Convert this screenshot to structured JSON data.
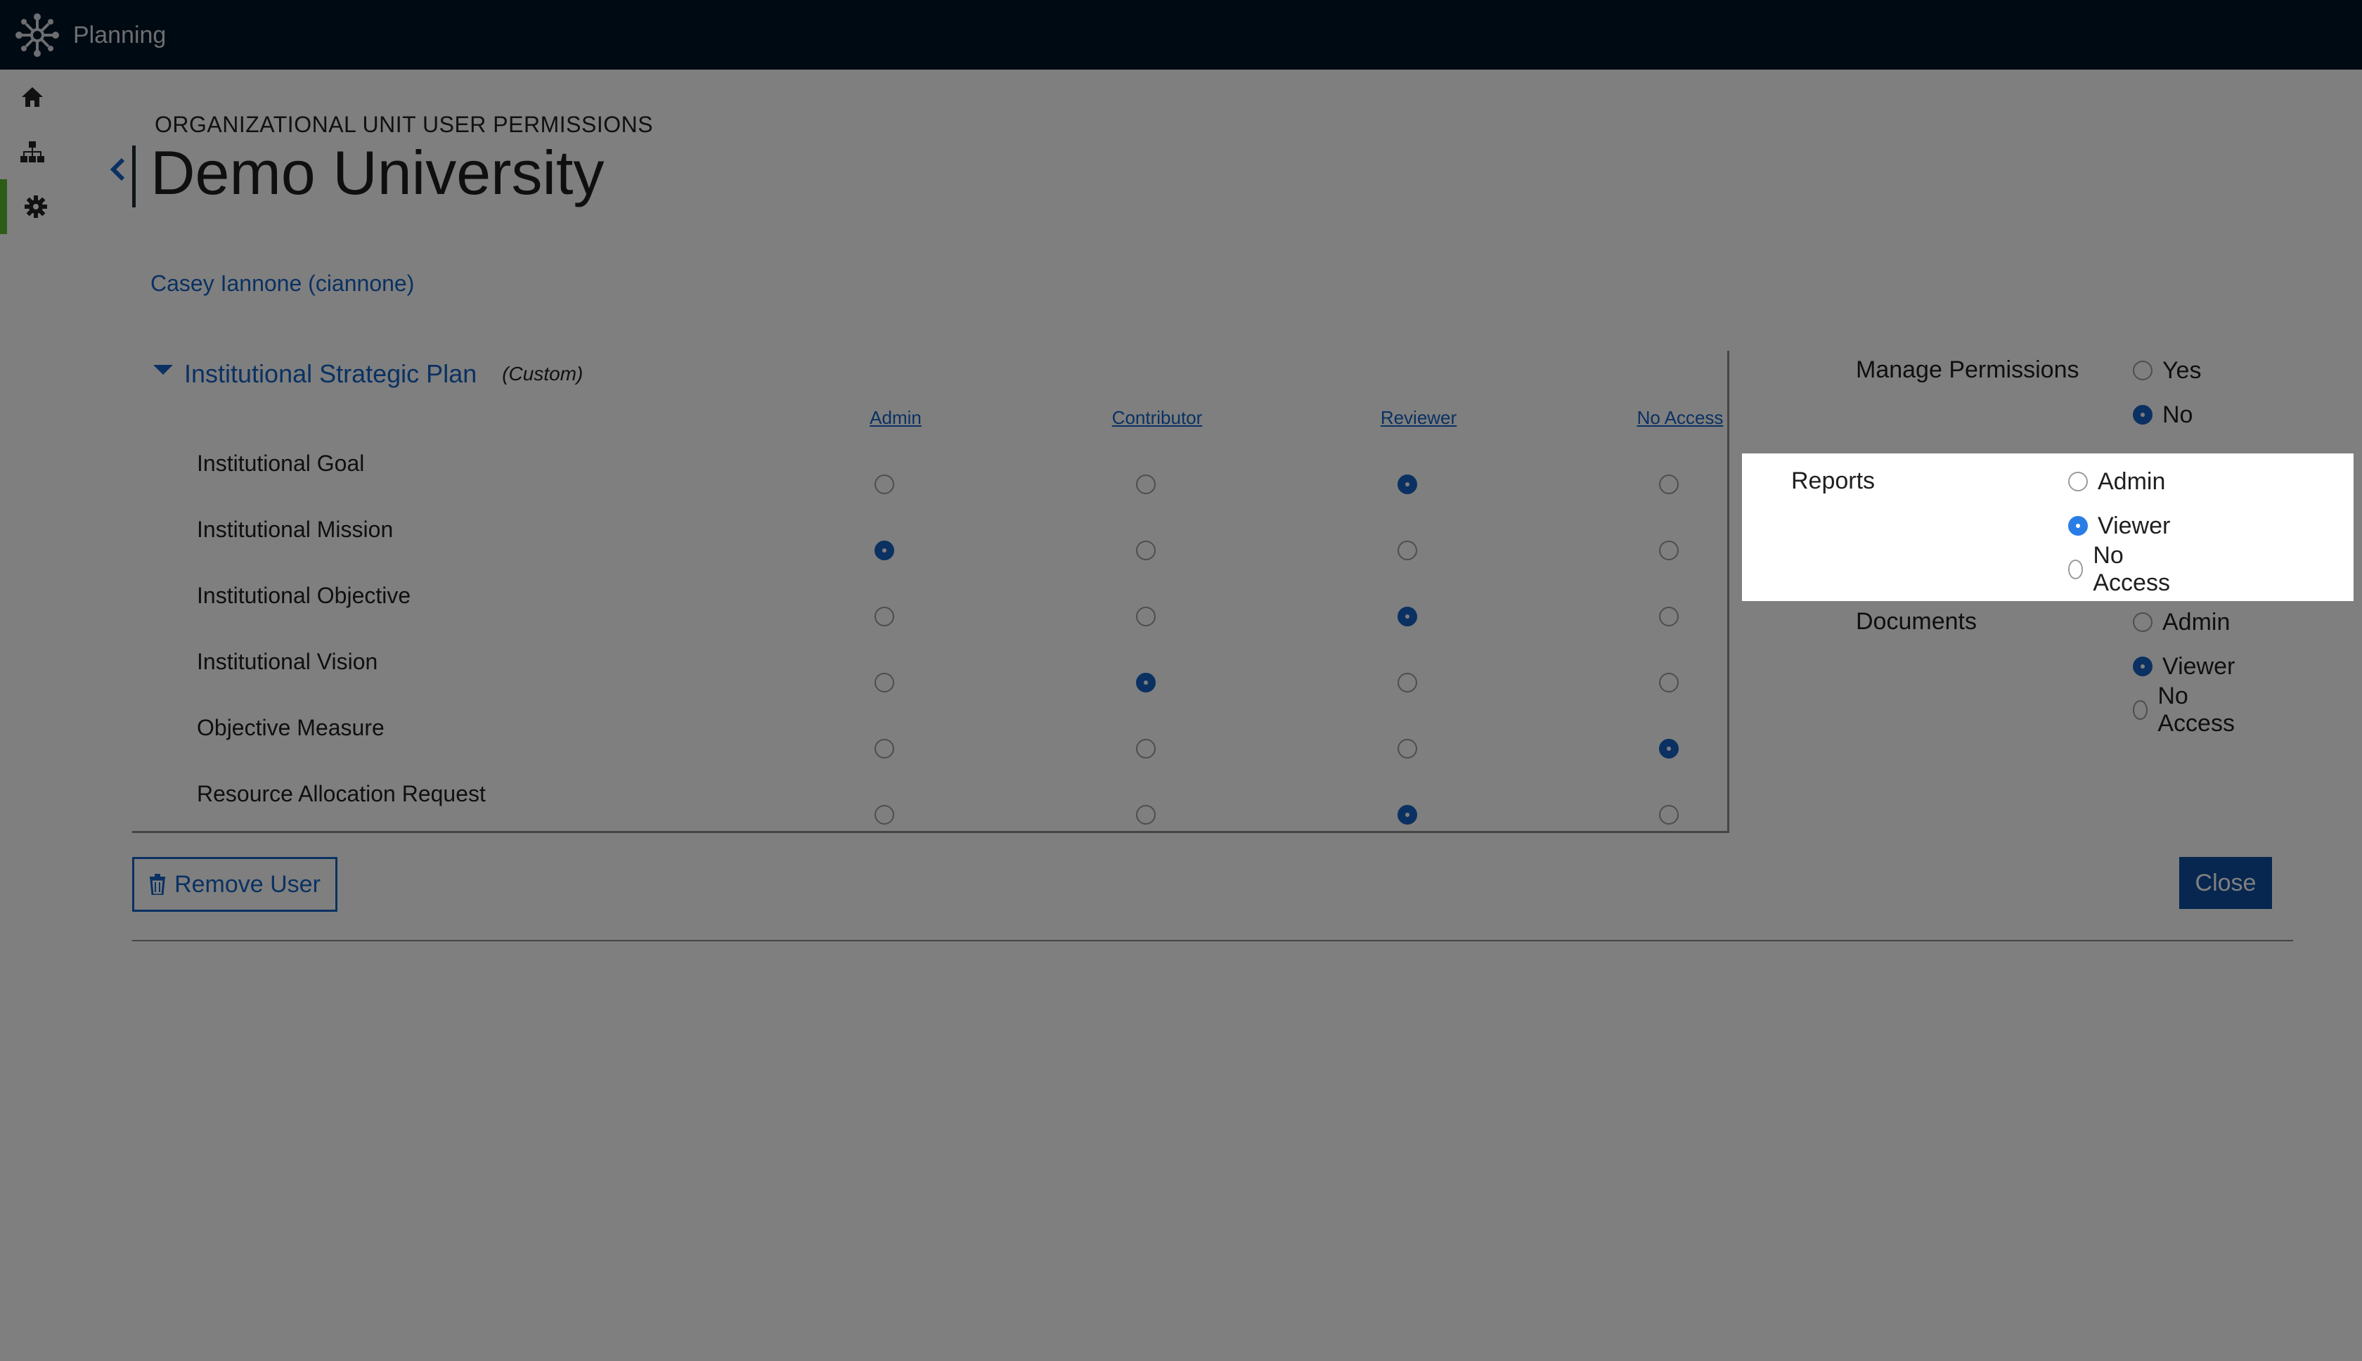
{
  "app": {
    "title": "Planning"
  },
  "sidebar": {
    "items": [
      {
        "icon": "home-icon"
      },
      {
        "icon": "org-chart-icon"
      },
      {
        "icon": "gear-icon",
        "active": true
      }
    ]
  },
  "page": {
    "eyebrow": "ORGANIZATIONAL UNIT USER PERMISSIONS",
    "title": "Demo University",
    "user": "Casey Iannone (ciannone)"
  },
  "plan": {
    "title": "Institutional Strategic Plan",
    "tag": "(Custom)",
    "columns": [
      "Admin",
      "Contributor",
      "Reviewer",
      "No Access"
    ],
    "rows": [
      {
        "label": "Institutional Goal",
        "selected": 2
      },
      {
        "label": "Institutional Mission",
        "selected": 0
      },
      {
        "label": "Institutional Objective",
        "selected": 2
      },
      {
        "label": "Institutional Vision",
        "selected": 1
      },
      {
        "label": "Objective Measure",
        "selected": 3
      },
      {
        "label": "Resource Allocation Request",
        "selected": 2
      }
    ]
  },
  "manage": {
    "label": "Manage Permissions",
    "options": [
      "Yes",
      "No"
    ],
    "selected": 1
  },
  "reports": {
    "label": "Reports",
    "options": [
      "Admin",
      "Viewer",
      "No Access"
    ],
    "selected": 1
  },
  "documents": {
    "label": "Documents",
    "options": [
      "Admin",
      "Viewer",
      "No Access"
    ],
    "selected": 1
  },
  "buttons": {
    "remove": "Remove User",
    "close": "Close"
  },
  "colors": {
    "accent": "#1463c4",
    "topbar": "#001526",
    "active_marker": "#5cb82c"
  }
}
